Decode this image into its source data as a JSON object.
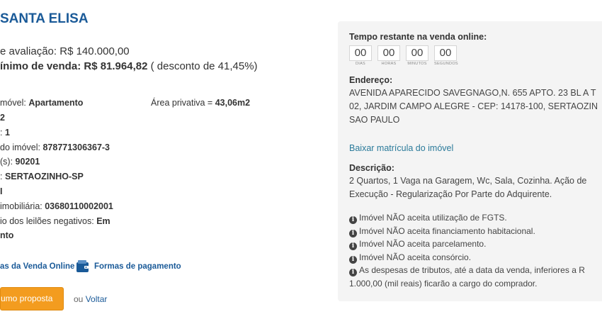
{
  "header": {
    "title": "SANTA ELISA"
  },
  "prices": {
    "evaluation_label": "e avaliação:",
    "evaluation_value": "R$ 140.000,00",
    "min_label": "ínimo de venda:",
    "min_value": "R$ 81.964,82",
    "discount": "( desconto de 41,45%)"
  },
  "details": {
    "type_label": "móvel:",
    "type_value": "Apartamento",
    "area_label": "Área privativa =",
    "area_value": "43,06m2",
    "rooms_value": "2",
    "parking_label": ":",
    "parking_value": "1",
    "property_label": "do imóvel:",
    "property_value": "878771306367-3",
    "registry_label": "(s):",
    "registry_value": "90201",
    "city_label": ":",
    "city_value": "SERTAOZINHO-SP",
    "office_value": "I",
    "realestate_label": "imobiliária:",
    "realestate_value": "03680110002001",
    "auction_label": "io dos leilões negativos:",
    "auction_value_1": "Em",
    "auction_value_2": "nto"
  },
  "links": {
    "online_sale_rules": "as da Venda Online",
    "payment_methods": "Formas de pagamento"
  },
  "actions": {
    "proposal_button": "umo proposta",
    "or": "ou",
    "back": "Voltar"
  },
  "panel": {
    "countdown_title": "Tempo restante na venda online:",
    "countdown": [
      {
        "value": "00",
        "label": "DIAS"
      },
      {
        "value": "00",
        "label": "HORAS"
      },
      {
        "value": "00",
        "label": "MINUTOS"
      },
      {
        "value": "00",
        "label": "SEGUNDOS"
      }
    ],
    "address_label": "Endereço:",
    "address_lines": [
      "AVENIDA APARECIDO SAVEGNAGO,N. 655 APTO. 23 BL A T",
      "02, JARDIM CAMPO ALEGRE - CEP: 14178-100, SERTAOZIN",
      "SAO PAULO"
    ],
    "matricula_link": "Baixar matrícula do imóvel",
    "description_label": "Descrição:",
    "description_lines": [
      "2 Quartos, 1 Vaga na Garagem, Wc, Sala, Cozinha. Ação de",
      "Execução - Regularização Por Parte do Adquirente."
    ],
    "notices": [
      "Imóvel NÃO aceita utilização de FGTS.",
      "Imóvel NÃO aceita financiamento habitacional.",
      "Imóvel NÃO aceita parcelamento.",
      "Imóvel NÃO aceita consórcio.",
      "As despesas de tributos, até a data da venda, inferiores a R"
    ],
    "notice_continuation": "1.000,00 (mil reais) ficarão a cargo do comprador.",
    "colors": {
      "panel_bg": "#f4f4f4",
      "accent": "#1a5a98",
      "button": "#f39c1f"
    }
  }
}
